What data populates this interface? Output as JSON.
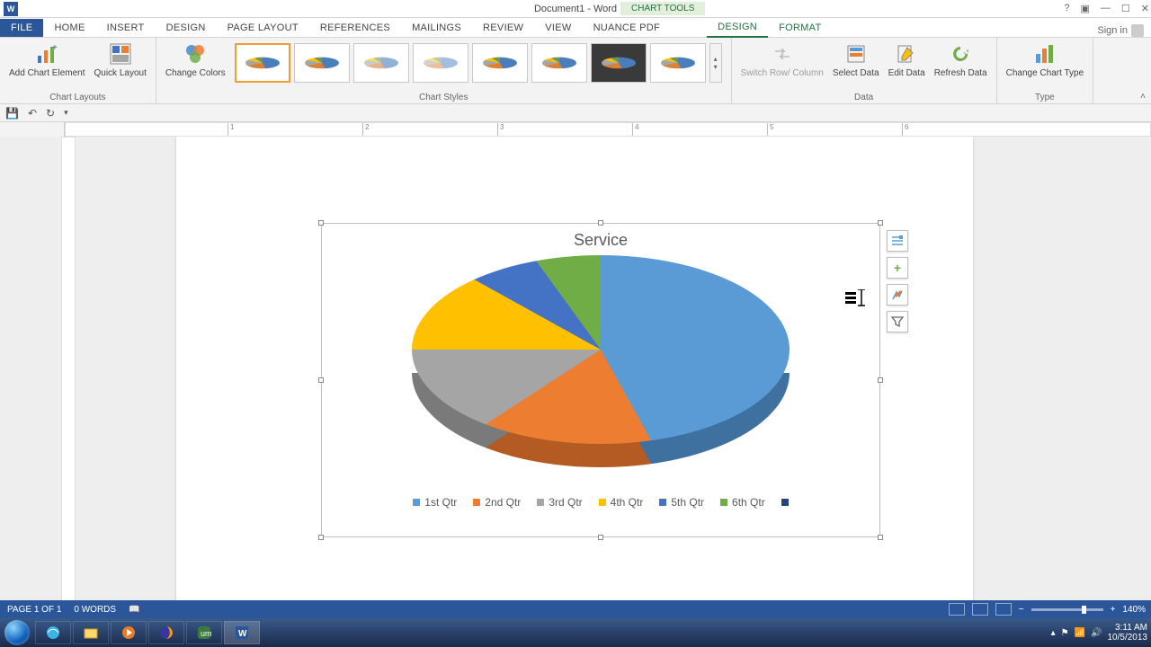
{
  "app": {
    "name": "Word",
    "doc_title": "Document1 - Word",
    "context_tools": "CHART TOOLS",
    "signin": "Sign in"
  },
  "tabs": {
    "file": "FILE",
    "items": [
      "HOME",
      "INSERT",
      "DESIGN",
      "PAGE LAYOUT",
      "REFERENCES",
      "MAILINGS",
      "REVIEW",
      "VIEW",
      "Nuance PDF"
    ],
    "context": [
      "DESIGN",
      "FORMAT"
    ],
    "active_context": "DESIGN"
  },
  "ribbon": {
    "groups": {
      "chart_layouts": {
        "label": "Chart Layouts",
        "add_element": "Add Chart Element",
        "quick_layout": "Quick Layout"
      },
      "chart_styles": {
        "label": "Chart Styles",
        "change_colors": "Change Colors"
      },
      "data": {
        "label": "Data",
        "switch": "Switch Row/ Column",
        "select": "Select Data",
        "edit": "Edit Data",
        "refresh": "Refresh Data"
      },
      "type": {
        "label": "Type",
        "change_type": "Change Chart Type"
      }
    }
  },
  "ruler_marks": [
    1,
    2,
    3,
    4,
    5,
    6
  ],
  "chart_data": {
    "type": "pie",
    "title": "Service",
    "categories": [
      "1st Qtr",
      "2nd Qtr",
      "3rd Qtr",
      "4th Qtr",
      "5th Qtr",
      "6th Qtr"
    ],
    "values": [
      42,
      24,
      9,
      8,
      7,
      10
    ],
    "colors": [
      "#5b9bd5",
      "#ed7d31",
      "#a5a5a5",
      "#ffc000",
      "#4472c4",
      "#70ad47"
    ],
    "legend_position": "bottom"
  },
  "chart_side": {
    "layout_options": "Layout Options",
    "add_element": "+",
    "styles": "Styles",
    "filter": "Filter"
  },
  "status": {
    "page": "PAGE 1 OF 1",
    "words": "0 WORDS",
    "zoom": "140%"
  },
  "taskbar": {
    "time": "3:11 AM",
    "date": "10/5/2013"
  }
}
